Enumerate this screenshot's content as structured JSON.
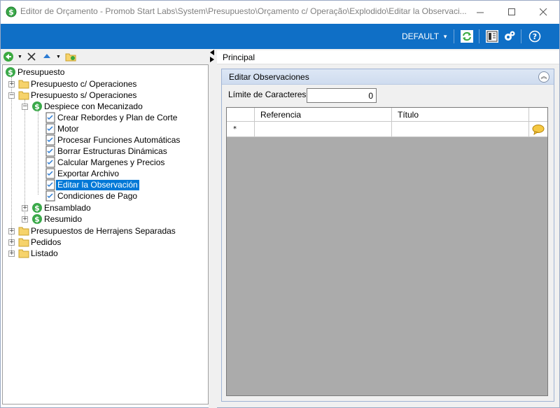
{
  "window": {
    "title": "Editor de Orçamento - Promob Start Labs\\System\\Presupuesto\\Orçamento c/ Operação\\Explodido\\Editar la Observaci...",
    "icon": "dollar-tree-icon"
  },
  "toolbar": {
    "profile_label": "DEFAULT",
    "accent": "#0f6fc6"
  },
  "tree": {
    "root": "Presupuesto",
    "items": [
      {
        "label": "Presupuesto c/ Operaciones"
      },
      {
        "label": "Presupuesto s/ Operaciones"
      },
      {
        "label": "Despiece con Mecanizado"
      },
      {
        "label": "Crear Rebordes y Plan de Corte"
      },
      {
        "label": "Motor"
      },
      {
        "label": "Procesar Funciones Automáticas"
      },
      {
        "label": "Borrar Estructuras Dinámicas"
      },
      {
        "label": "Calcular Margenes y Precios"
      },
      {
        "label": "Exportar Archivo"
      },
      {
        "label": "Editar la Observación"
      },
      {
        "label": "Condiciones de Pago"
      },
      {
        "label": "Ensamblado"
      },
      {
        "label": "Resumido"
      },
      {
        "label": "Presupuestos de Herrajens Separadas"
      },
      {
        "label": "Pedidos"
      },
      {
        "label": "Listado"
      }
    ],
    "selected": "Editar la Observación"
  },
  "main": {
    "tab_label": "Principal",
    "group_title": "Editar Observaciones",
    "limit_label": "Límite de Caracteres",
    "limit_value": "0",
    "grid": {
      "columns": [
        "Referencia",
        "Título"
      ],
      "new_row_marker": "*"
    }
  }
}
